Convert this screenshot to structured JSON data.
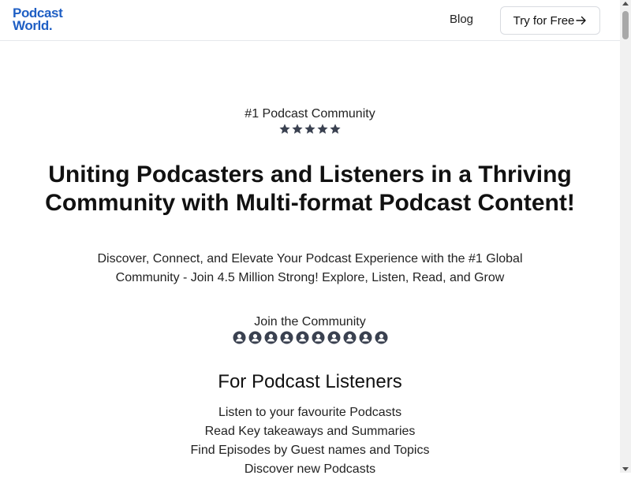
{
  "header": {
    "logo_line1": "Podcast",
    "logo_line2": "World.",
    "nav_blog": "Blog",
    "cta_label": "Try for Free"
  },
  "hero": {
    "badge": "#1 Podcast Community",
    "rating_stars": 5,
    "headline_line1": "Uniting Podcasters and Listeners in a Thriving",
    "headline_line2": "Community with Multi-format Podcast Content!",
    "subtext_line1": "Discover, Connect, and Elevate Your Podcast Experience with the #1 Global",
    "subtext_line2": "Community - Join 4.5 Million Strong! Explore, Listen, Read, and Grow",
    "join_label": "Join the Community",
    "avatar_count": 10
  },
  "listeners": {
    "title": "For Podcast Listeners",
    "items": [
      "Listen to your favourite Podcasts",
      "Read Key takeaways and Summaries",
      "Find Episodes by Guest names and Topics",
      "Discover new Podcasts"
    ]
  },
  "colors": {
    "brand": "#1f5fc4",
    "icon": "#3a4150",
    "text": "#111111",
    "border": "#d8dbe0"
  },
  "icons": {
    "star": "star-icon",
    "avatar": "user-avatar-icon",
    "arrow": "arrow-right-icon",
    "mic": "microphone-icon"
  }
}
